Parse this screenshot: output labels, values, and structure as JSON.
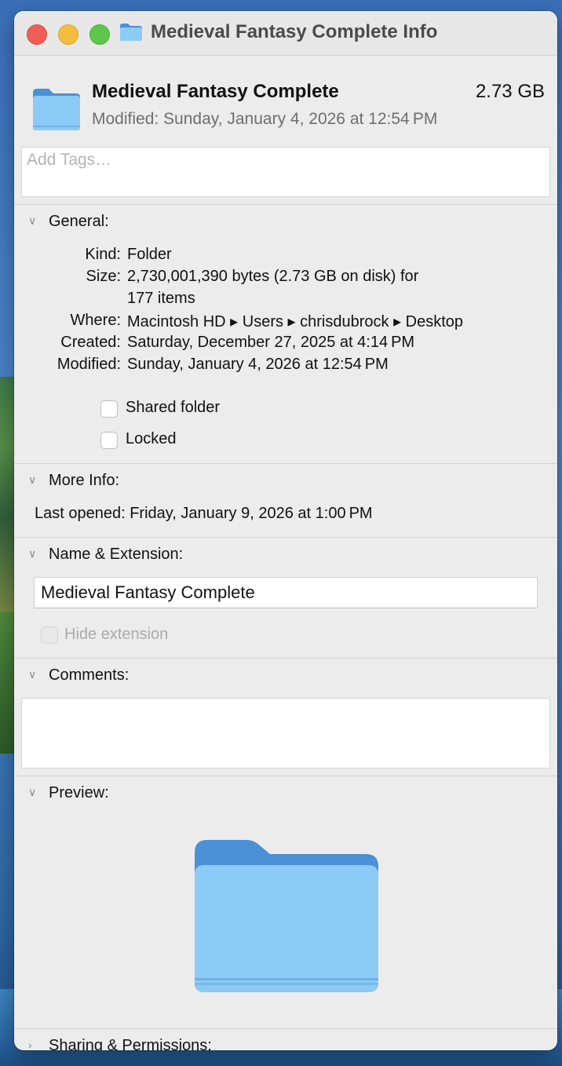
{
  "window": {
    "title": "Medieval Fantasy Complete Info"
  },
  "header": {
    "name": "Medieval Fantasy Complete",
    "size": "2.73 GB",
    "modified": "Modified: Sunday, January 4, 2026 at 12:54 PM"
  },
  "tags": {
    "placeholder": "Add Tags…"
  },
  "general": {
    "heading": "General:",
    "rows": [
      {
        "key": "Kind:",
        "value": "Folder"
      },
      {
        "key": "Size:",
        "value": "2,730,001,390 bytes (2.73 GB on disk) for",
        "value2": "177 items"
      },
      {
        "key": "Where:",
        "value": "Macintosh HD ▸ Users ▸ chrisdubrock ▸ Desktop"
      },
      {
        "key": "Created:",
        "value": "Saturday, December 27, 2025 at 4:14 PM"
      },
      {
        "key": "Modified:",
        "value": "Sunday, January 4, 2026 at 12:54 PM"
      }
    ],
    "shared_folder_label": "Shared folder",
    "shared_folder_checked": false,
    "locked_label": "Locked",
    "locked_checked": false
  },
  "more_info": {
    "heading": "More Info:",
    "last_opened": "Last opened: Friday, January 9, 2026 at 1:00 PM"
  },
  "name_extension": {
    "heading": "Name & Extension:",
    "value": "Medieval Fantasy Complete",
    "hide_extension_label": "Hide extension",
    "hide_extension_checked": false
  },
  "comments": {
    "heading": "Comments:",
    "value": ""
  },
  "preview": {
    "heading": "Preview:"
  },
  "sharing": {
    "heading": "Sharing & Permissions:"
  },
  "colors": {
    "folder_light": "#8ccbf5",
    "folder_dark": "#4a90d6",
    "window_bg": "#ececec"
  }
}
